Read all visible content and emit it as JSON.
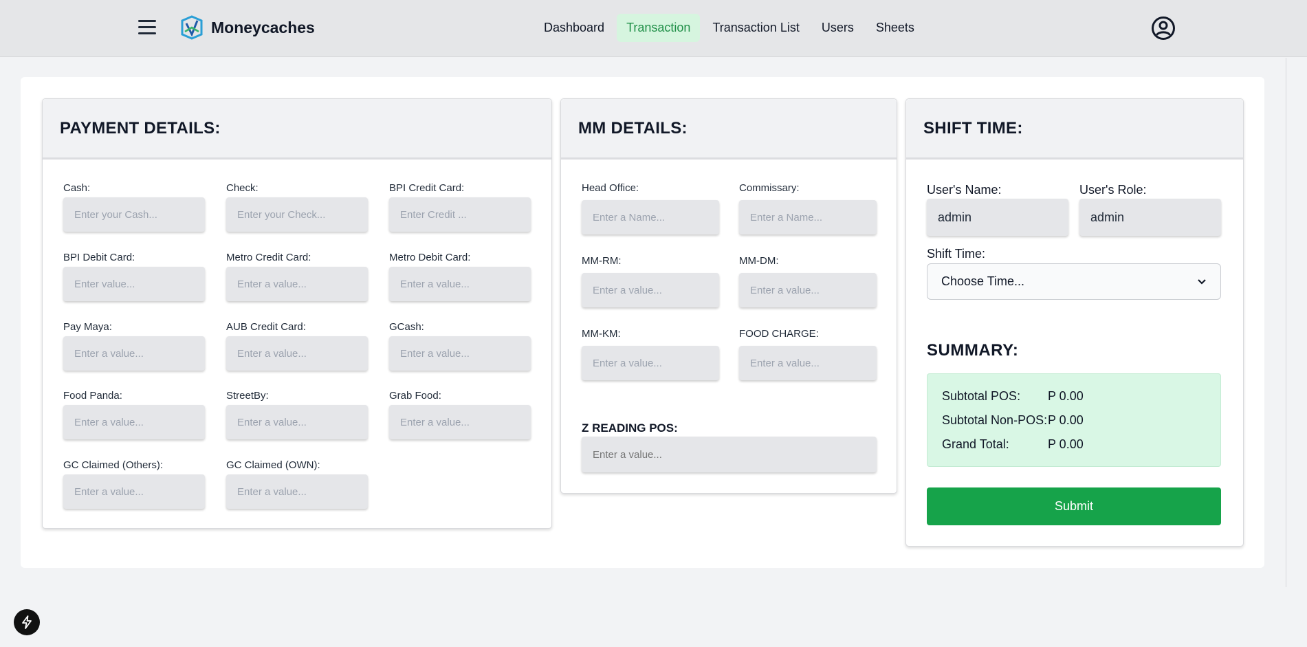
{
  "header": {
    "brand_name": "Moneycaches",
    "nav": [
      {
        "label": "Dashboard",
        "active": false
      },
      {
        "label": "Transaction",
        "active": true
      },
      {
        "label": "Transaction List",
        "active": false
      },
      {
        "label": "Users",
        "active": false
      },
      {
        "label": "Sheets",
        "active": false
      }
    ],
    "icons": {
      "menu": "hamburger-icon",
      "account": "user-circle-icon",
      "logo": "logo-icon"
    }
  },
  "payment": {
    "title": "PAYMENT DETAILS:",
    "fields": [
      {
        "label": "Cash:",
        "placeholder": "Enter your Cash..."
      },
      {
        "label": "Check:",
        "placeholder": "Enter your Check..."
      },
      {
        "label": "BPI Credit Card:",
        "placeholder": "Enter Credit ..."
      },
      {
        "label": "BPI Debit Card:",
        "placeholder": "Enter value..."
      },
      {
        "label": "Metro Credit Card:",
        "placeholder": "Enter a value..."
      },
      {
        "label": "Metro Debit Card:",
        "placeholder": "Enter a value..."
      },
      {
        "label": "Pay Maya:",
        "placeholder": "Enter a value..."
      },
      {
        "label": "AUB Credit Card:",
        "placeholder": "Enter a value..."
      },
      {
        "label": "GCash:",
        "placeholder": "Enter a value..."
      },
      {
        "label": "Food Panda:",
        "placeholder": "Enter a value..."
      },
      {
        "label": "StreetBy:",
        "placeholder": "Enter a value..."
      },
      {
        "label": "Grab Food:",
        "placeholder": "Enter a value..."
      },
      {
        "label": "GC Claimed (Others):",
        "placeholder": "Enter a value..."
      },
      {
        "label": "GC Claimed (OWN):",
        "placeholder": "Enter a value..."
      }
    ]
  },
  "mm": {
    "title": "MM DETAILS:",
    "fields": [
      {
        "label": "Head Office:",
        "placeholder": "Enter a Name..."
      },
      {
        "label": "Commissary:",
        "placeholder": "Enter a Name..."
      },
      {
        "label": "MM-RM:",
        "placeholder": "Enter a value..."
      },
      {
        "label": "MM-DM:",
        "placeholder": "Enter a value..."
      },
      {
        "label": "MM-KM:",
        "placeholder": "Enter a value..."
      },
      {
        "label": "FOOD CHARGE:",
        "placeholder": "Enter a value..."
      }
    ],
    "z_reading_label": "Z READING POS:",
    "z_reading_placeholder": "Enter a value..."
  },
  "shift": {
    "title": "SHIFT TIME:",
    "user_name_label": "User's Name:",
    "user_name_value": "admin",
    "user_role_label": "User's Role:",
    "user_role_value": "admin",
    "shift_time_label": "Shift Time:",
    "shift_time_selected": "Choose Time...",
    "summary_title": "SUMMARY:",
    "summary": [
      {
        "label": "Subtotal POS:",
        "value": "P 0.00"
      },
      {
        "label": "Subtotal Non-POS:",
        "value": "P 0.00"
      },
      {
        "label": "Grand Total:",
        "value": "P 0.00"
      }
    ],
    "submit_label": "Submit"
  },
  "colors": {
    "accent_green": "#16a34a",
    "active_nav_bg": "#d6f5df",
    "summary_bg": "#d9f7e5"
  }
}
